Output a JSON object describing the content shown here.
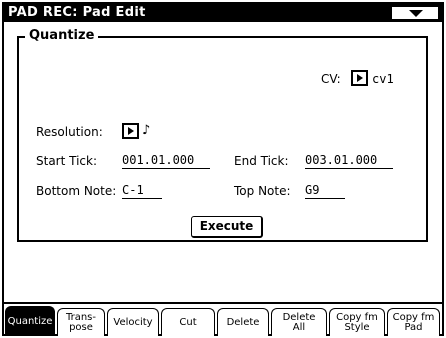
{
  "window": {
    "title": "PAD REC: Pad Edit",
    "menu_icon": "triangle-down-icon"
  },
  "quantize": {
    "legend": "Quantize",
    "cv_label": "CV:",
    "cv_value": "cv1",
    "resolution_label": "Resolution:",
    "resolution_value": "♪",
    "start_tick_label": "Start Tick:",
    "start_tick_value": "001.01.000",
    "end_tick_label": "End Tick:",
    "end_tick_value": "003.01.000",
    "bottom_note_label": "Bottom Note:",
    "bottom_note_value": "C-1",
    "top_note_label": "Top Note:",
    "top_note_value": "G9",
    "execute_label": "Execute"
  },
  "tabs": [
    {
      "line1": "Quantize",
      "line2": "",
      "active": true
    },
    {
      "line1": "Trans-",
      "line2": "pose",
      "active": false
    },
    {
      "line1": "Velocity",
      "line2": "",
      "active": false
    },
    {
      "line1": "Cut",
      "line2": "",
      "active": false
    },
    {
      "line1": "Delete",
      "line2": "",
      "active": false
    },
    {
      "line1": "Delete",
      "line2": "All",
      "active": false
    },
    {
      "line1": "Copy fm",
      "line2": "Style",
      "active": false
    },
    {
      "line1": "Copy fm",
      "line2": "Pad",
      "active": false
    }
  ]
}
